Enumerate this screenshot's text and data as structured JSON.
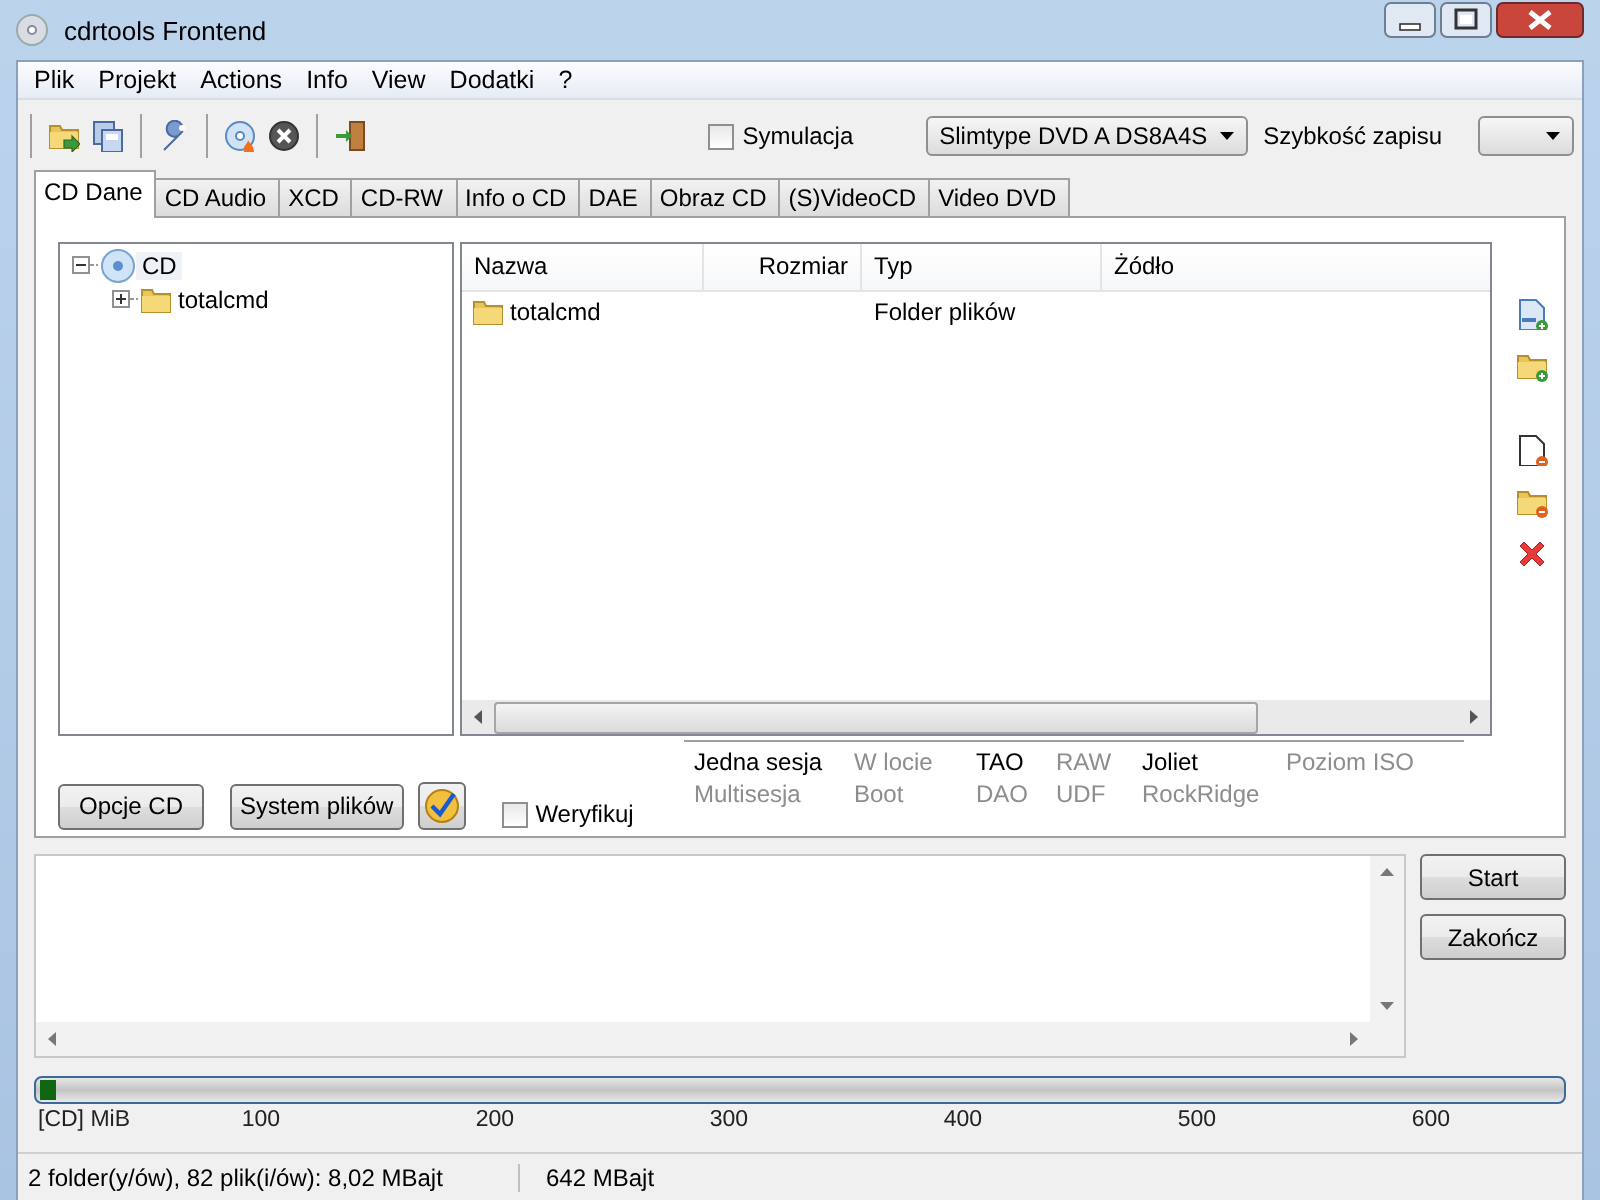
{
  "window": {
    "title": "cdrtools Frontend"
  },
  "menu": [
    "Plik",
    "Projekt",
    "Actions",
    "Info",
    "View",
    "Dodatki",
    "?"
  ],
  "toolbar": {
    "simulation": {
      "label": "Symulacja",
      "checked": false
    },
    "drive": {
      "value": "Slimtype DVD A DS8A4S"
    },
    "speed_label": "Szybkość zapisu"
  },
  "tabs": [
    {
      "label": "CD Dane",
      "selected": true
    },
    {
      "label": "CD Audio",
      "selected": false
    },
    {
      "label": "XCD",
      "selected": false
    },
    {
      "label": "CD-RW",
      "selected": false
    },
    {
      "label": "Info o CD",
      "selected": false
    },
    {
      "label": "DAE",
      "selected": false
    },
    {
      "label": "Obraz CD",
      "selected": false
    },
    {
      "label": "(S)VideoCD",
      "selected": false
    },
    {
      "label": "Video DVD",
      "selected": false
    }
  ],
  "tree": [
    {
      "label": "CD",
      "kind": "disc",
      "expanded": true,
      "children": [
        {
          "label": "totalcmd",
          "kind": "folder",
          "expanded": false
        }
      ]
    }
  ],
  "table": {
    "columns": [
      "Nazwa",
      "Rozmiar",
      "Typ",
      "Żódło"
    ],
    "rows": [
      {
        "name": "totalcmd",
        "type": "Folder plików"
      }
    ]
  },
  "buttons": [
    "Opcje CD",
    "System plików"
  ],
  "verify": {
    "label": "Weryfikuj",
    "checked": false
  },
  "flags": [
    {
      "label": "Jedna sesja",
      "enabled": true
    },
    {
      "label": "W locie",
      "enabled": false
    },
    {
      "label": "TAO",
      "enabled": true
    },
    {
      "label": "RAW",
      "enabled": false
    },
    {
      "label": "Joliet",
      "enabled": true
    },
    {
      "label": "Poziom ISO",
      "enabled": false
    },
    {
      "label": "Multisesja",
      "enabled": false
    },
    {
      "label": "Boot",
      "enabled": false
    },
    {
      "label": "DAO",
      "enabled": false
    },
    {
      "label": "UDF",
      "enabled": false
    },
    {
      "label": "RockRidge",
      "enabled": false
    }
  ],
  "actions": [
    "Start",
    "Zakończ"
  ],
  "capacity": {
    "level": 0.01,
    "unit": "[CD] MiB",
    "ticks": [
      "100",
      "200",
      "300",
      "400",
      "500",
      "600"
    ]
  },
  "status_bar": [
    "2 folder(y/ów), 82 plik(i/ów): 8,02 MBajt",
    "642 MBajt"
  ]
}
